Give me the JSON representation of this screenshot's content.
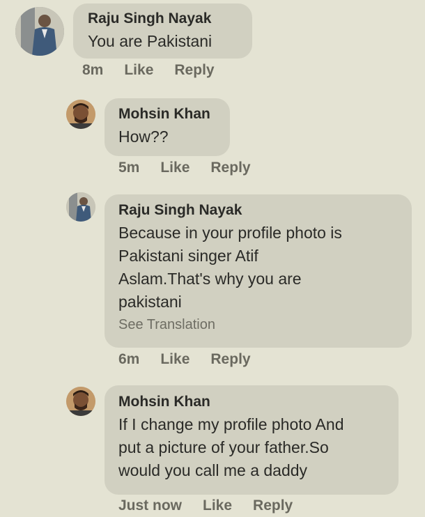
{
  "comments": [
    {
      "author": "Raju Singh Nayak",
      "text": "You are Pakistani",
      "time": "8m",
      "like": "Like",
      "reply": "Reply",
      "avatar_icon": "person-suit-avatar-icon"
    },
    {
      "author": "Mohsin Khan",
      "text": "How??",
      "time": "5m",
      "like": "Like",
      "reply": "Reply",
      "avatar_icon": "person-face-avatar-icon"
    },
    {
      "author": "Raju Singh Nayak",
      "text": "Because in your profile photo is\nPakistani singer Atif\nAslam.That's why you are\npakistani",
      "see_translation": "See Translation",
      "time": "6m",
      "like": "Like",
      "reply": "Reply",
      "avatar_icon": "person-suit-avatar-icon"
    },
    {
      "author": "Mohsin Khan",
      "text": "If I change my profile photo And\nput a picture of your father.So\nwould you call me a daddy",
      "time": "Just now",
      "like": "Like",
      "reply": "Reply",
      "avatar_icon": "person-face-avatar-icon"
    }
  ],
  "colors": {
    "background": "#e4e3d3",
    "bubble": "#d1d0c1",
    "action_text": "#6a695f"
  }
}
